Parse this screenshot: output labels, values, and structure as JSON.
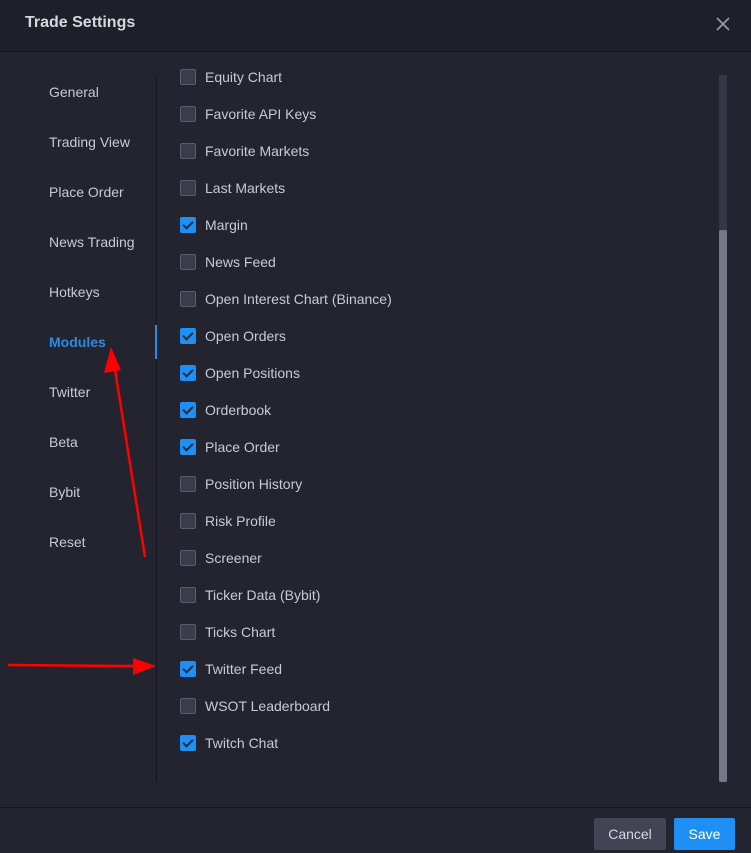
{
  "header": {
    "title": "Trade Settings",
    "close_icon": "close-icon"
  },
  "sidebar": {
    "active": "Modules",
    "items": [
      {
        "label": "General"
      },
      {
        "label": "Trading View"
      },
      {
        "label": "Place Order"
      },
      {
        "label": "News Trading"
      },
      {
        "label": "Hotkeys"
      },
      {
        "label": "Modules"
      },
      {
        "label": "Twitter"
      },
      {
        "label": "Beta"
      },
      {
        "label": "Bybit"
      },
      {
        "label": "Reset"
      }
    ]
  },
  "modules": [
    {
      "label": "Equity Chart",
      "checked": false
    },
    {
      "label": "Favorite API Keys",
      "checked": false
    },
    {
      "label": "Favorite Markets",
      "checked": false
    },
    {
      "label": "Last Markets",
      "checked": false
    },
    {
      "label": "Margin",
      "checked": true
    },
    {
      "label": "News Feed",
      "checked": false
    },
    {
      "label": "Open Interest Chart (Binance)",
      "checked": false
    },
    {
      "label": "Open Orders",
      "checked": true
    },
    {
      "label": "Open Positions",
      "checked": true
    },
    {
      "label": "Orderbook",
      "checked": true
    },
    {
      "label": "Place Order",
      "checked": true
    },
    {
      "label": "Position History",
      "checked": false
    },
    {
      "label": "Risk Profile",
      "checked": false
    },
    {
      "label": "Screener",
      "checked": false
    },
    {
      "label": "Ticker Data (Bybit)",
      "checked": false
    },
    {
      "label": "Ticks Chart",
      "checked": false
    },
    {
      "label": "Twitter Feed",
      "checked": true
    },
    {
      "label": "WSOT Leaderboard",
      "checked": false
    },
    {
      "label": "Twitch Chat",
      "checked": true
    }
  ],
  "footer": {
    "cancel_label": "Cancel",
    "save_label": "Save"
  },
  "colors": {
    "accent": "#1e90f5",
    "active_nav": "#2a8be5",
    "annotation": "#ff0000"
  }
}
